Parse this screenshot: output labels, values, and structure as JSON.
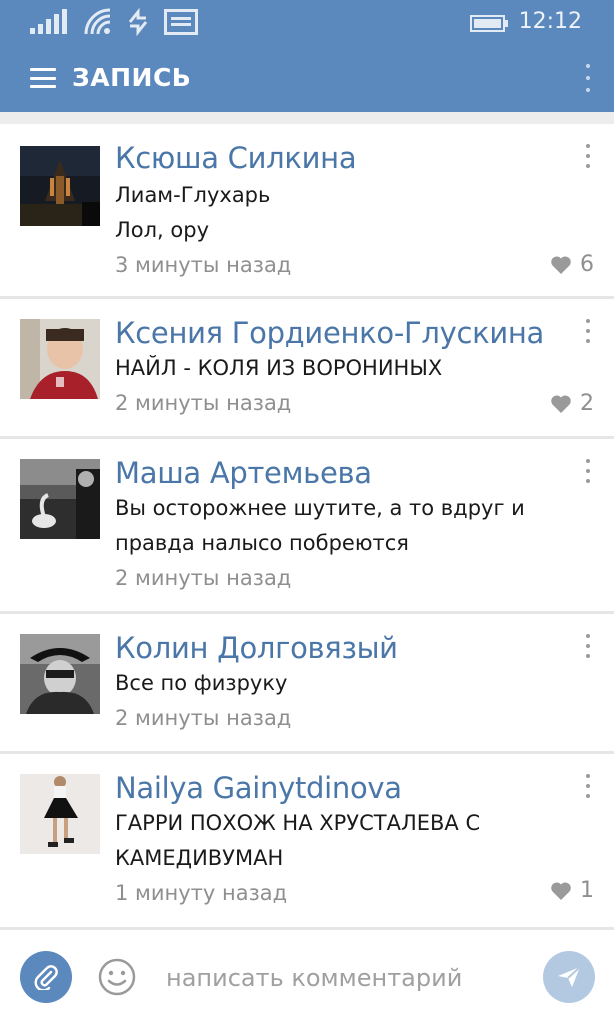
{
  "status_bar": {
    "time": "12:12",
    "icons": [
      "signal-icon",
      "wifi-icon",
      "data-transfer-icon",
      "message-icon",
      "battery-icon"
    ]
  },
  "app_bar": {
    "title": "ЗАПИСЬ",
    "menu_icon": "hamburger-menu-icon",
    "more_icon": "more-vertical-icon"
  },
  "comments": [
    {
      "author": "Ксюша Силкина",
      "lines": [
        "Лиам-Глухарь",
        "Лол, ору"
      ],
      "time": "3 минуты назад",
      "likes": "6"
    },
    {
      "author": "Ксения Гордиенко-Глускина",
      "lines": [
        "НАЙЛ - КОЛЯ ИЗ ВОРОНИНЫХ"
      ],
      "time": "2 минуты назад",
      "likes": "2"
    },
    {
      "author": "Маша Артемьева",
      "lines": [
        "Вы осторожнее шутите, а то вдруг и",
        "правда налысо побреются"
      ],
      "time": "2 минуты назад",
      "likes": ""
    },
    {
      "author": "Колин Долговязый",
      "lines": [
        "Все по физруку"
      ],
      "time": "2 минуты назад",
      "likes": ""
    },
    {
      "author": "Nailya Gainytdinova",
      "lines": [
        "ГАРРИ ПОХОЖ НА ХРУСТАЛЕВА  С",
        "КАМЕДИВУМАН"
      ],
      "time": "1 минуту назад",
      "likes": "1"
    }
  ],
  "composer": {
    "placeholder": "написать комментарий",
    "value": ""
  },
  "colors": {
    "accent": "#5b88bd",
    "name_link": "#4a76a8",
    "muted": "#8f8f8f",
    "send_disabled": "#b3c9e2"
  }
}
